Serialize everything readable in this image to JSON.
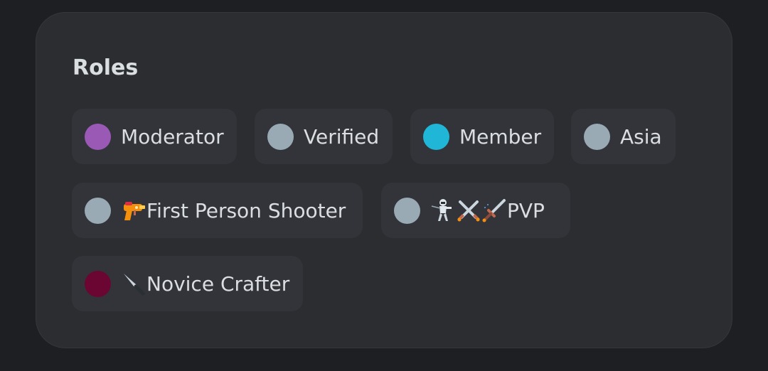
{
  "section": {
    "title": "Roles"
  },
  "roles": [
    {
      "label": "Moderator",
      "color": "#9b59b6"
    },
    {
      "label": "Verified",
      "color": "#99aab5"
    },
    {
      "label": "Member",
      "color": "#1fb6d7"
    },
    {
      "label": "Asia",
      "color": "#99aab5"
    },
    {
      "label": "First Person Shooter",
      "color": "#99aab5",
      "emoji": [
        "water-pistol-icon"
      ]
    },
    {
      "label": "PVP",
      "color": "#99aab5",
      "emoji": [
        "person-fencing-icon",
        "crossed-swords-icon",
        "dagger-icon"
      ]
    },
    {
      "label": "Novice Crafter",
      "color": "#6b0633",
      "emoji": [
        "kitchen-knife-icon"
      ]
    }
  ]
}
